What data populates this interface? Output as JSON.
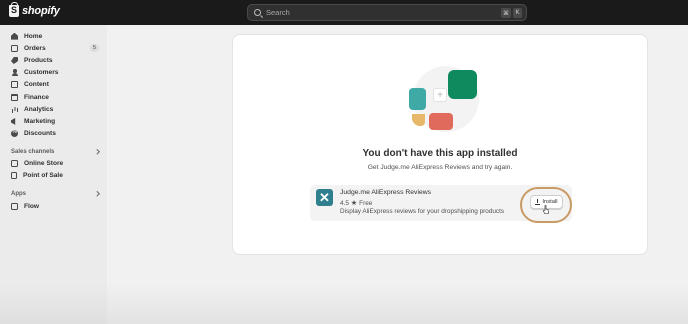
{
  "topbar": {
    "brand": "shopify",
    "search_placeholder": "Search",
    "shortcut_keys": [
      "⌘",
      "K"
    ]
  },
  "sidebar": {
    "items": [
      {
        "label": "Home",
        "icon": "home-icon"
      },
      {
        "label": "Orders",
        "icon": "orders-icon",
        "badge": "5"
      },
      {
        "label": "Products",
        "icon": "tag-icon"
      },
      {
        "label": "Customers",
        "icon": "person-icon"
      },
      {
        "label": "Content",
        "icon": "content-icon"
      },
      {
        "label": "Finance",
        "icon": "bank-icon"
      },
      {
        "label": "Analytics",
        "icon": "chart-icon"
      },
      {
        "label": "Marketing",
        "icon": "megaphone-icon"
      },
      {
        "label": "Discounts",
        "icon": "discount-icon"
      }
    ],
    "sales_channels": {
      "heading": "Sales channels",
      "items": [
        {
          "label": "Online Store",
          "icon": "store-icon"
        },
        {
          "label": "Point of Sale",
          "icon": "pos-icon"
        }
      ]
    },
    "apps": {
      "heading": "Apps",
      "items": [
        {
          "label": "Flow",
          "icon": "flow-icon"
        }
      ]
    }
  },
  "main": {
    "title": "You don't have this app installed",
    "subtitle": "Get Judge.me AliExpress Reviews and try again.",
    "app": {
      "name": "Judge.me AliExpress Reviews",
      "rating": "4.5",
      "price": "Free",
      "description": "Display AliExpress reviews for your dropshipping products",
      "install_label": "Install"
    }
  },
  "colors": {
    "topbar_bg": "#1a1a1a",
    "sidebar_bg": "#ebebeb",
    "page_bg": "#f1f1f1",
    "highlight_ring": "#c99a63",
    "app_icon_bg": "#2f7f8f",
    "illus_teal": "#3fa9a6",
    "illus_green": "#0f8a5f",
    "illus_red": "#e06a5c",
    "illus_yellow": "#e8b86a"
  }
}
